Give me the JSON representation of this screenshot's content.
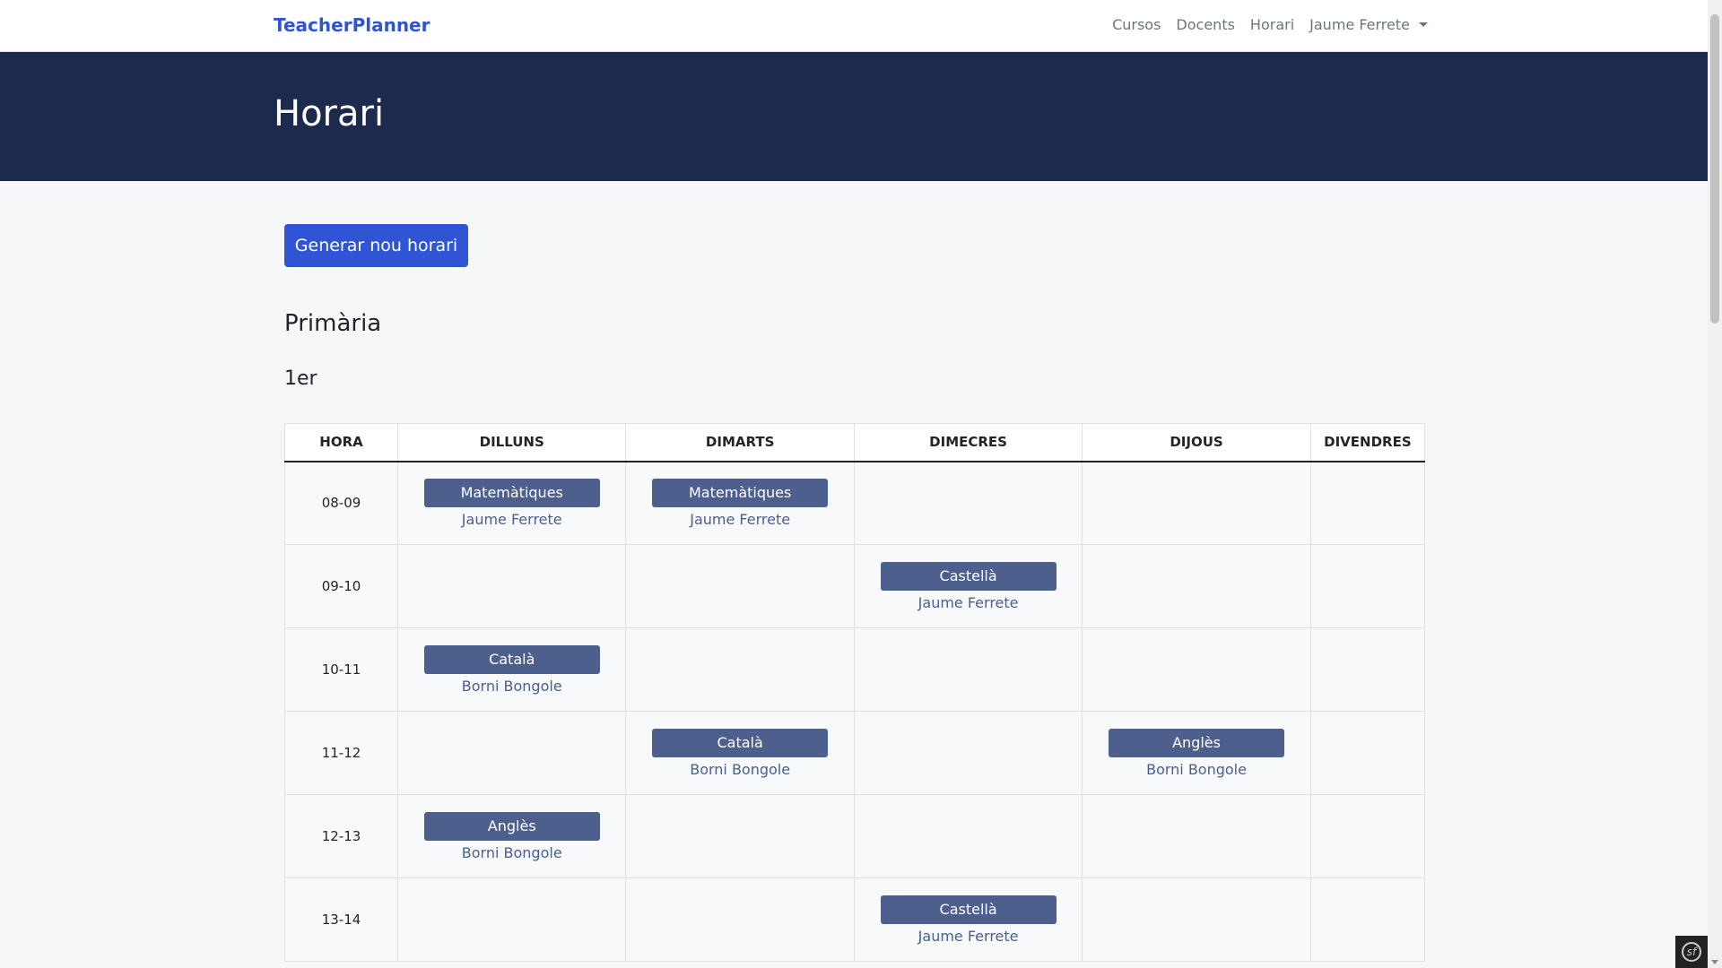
{
  "navbar": {
    "brand": "TeacherPlanner",
    "links": [
      "Cursos",
      "Docents",
      "Horari"
    ],
    "user": "Jaume Ferrete"
  },
  "hero": {
    "title": "Horari"
  },
  "actions": {
    "generate_label": "Generar nou horari"
  },
  "level": {
    "title": "Primària"
  },
  "course": {
    "title": "1er"
  },
  "table": {
    "headers": [
      "HORA",
      "DILLUNS",
      "DIMARTS",
      "DIMECRES",
      "DIJOUS",
      "DIVENDRES"
    ],
    "rows": [
      {
        "hour": "08-09",
        "cells": [
          {
            "subject": "Matemàtiques",
            "teacher": "Jaume Ferrete"
          },
          {
            "subject": "Matemàtiques",
            "teacher": "Jaume Ferrete"
          },
          null,
          null,
          null
        ]
      },
      {
        "hour": "09-10",
        "cells": [
          null,
          null,
          {
            "subject": "Castellà",
            "teacher": "Jaume Ferrete"
          },
          null,
          null
        ]
      },
      {
        "hour": "10-11",
        "cells": [
          {
            "subject": "Català",
            "teacher": "Borni Bongole"
          },
          null,
          null,
          null,
          null
        ]
      },
      {
        "hour": "11-12",
        "cells": [
          null,
          {
            "subject": "Català",
            "teacher": "Borni Bongole"
          },
          null,
          {
            "subject": "Anglès",
            "teacher": "Borni Bongole"
          },
          null
        ]
      },
      {
        "hour": "12-13",
        "cells": [
          {
            "subject": "Anglès",
            "teacher": "Borni Bongole"
          },
          null,
          null,
          null,
          null
        ]
      },
      {
        "hour": "13-14",
        "cells": [
          null,
          null,
          {
            "subject": "Castellà",
            "teacher": "Jaume Ferrete"
          },
          null,
          null
        ]
      }
    ]
  },
  "colors": {
    "brand": "#2f55d4",
    "hero_bg": "#1c2a4e",
    "subject_badge": "#4d5f8c",
    "teacher_text": "#4a5e8f"
  },
  "icons": {
    "user_menu": "caret-down-icon",
    "debug_toolbar": "symfony-icon"
  }
}
